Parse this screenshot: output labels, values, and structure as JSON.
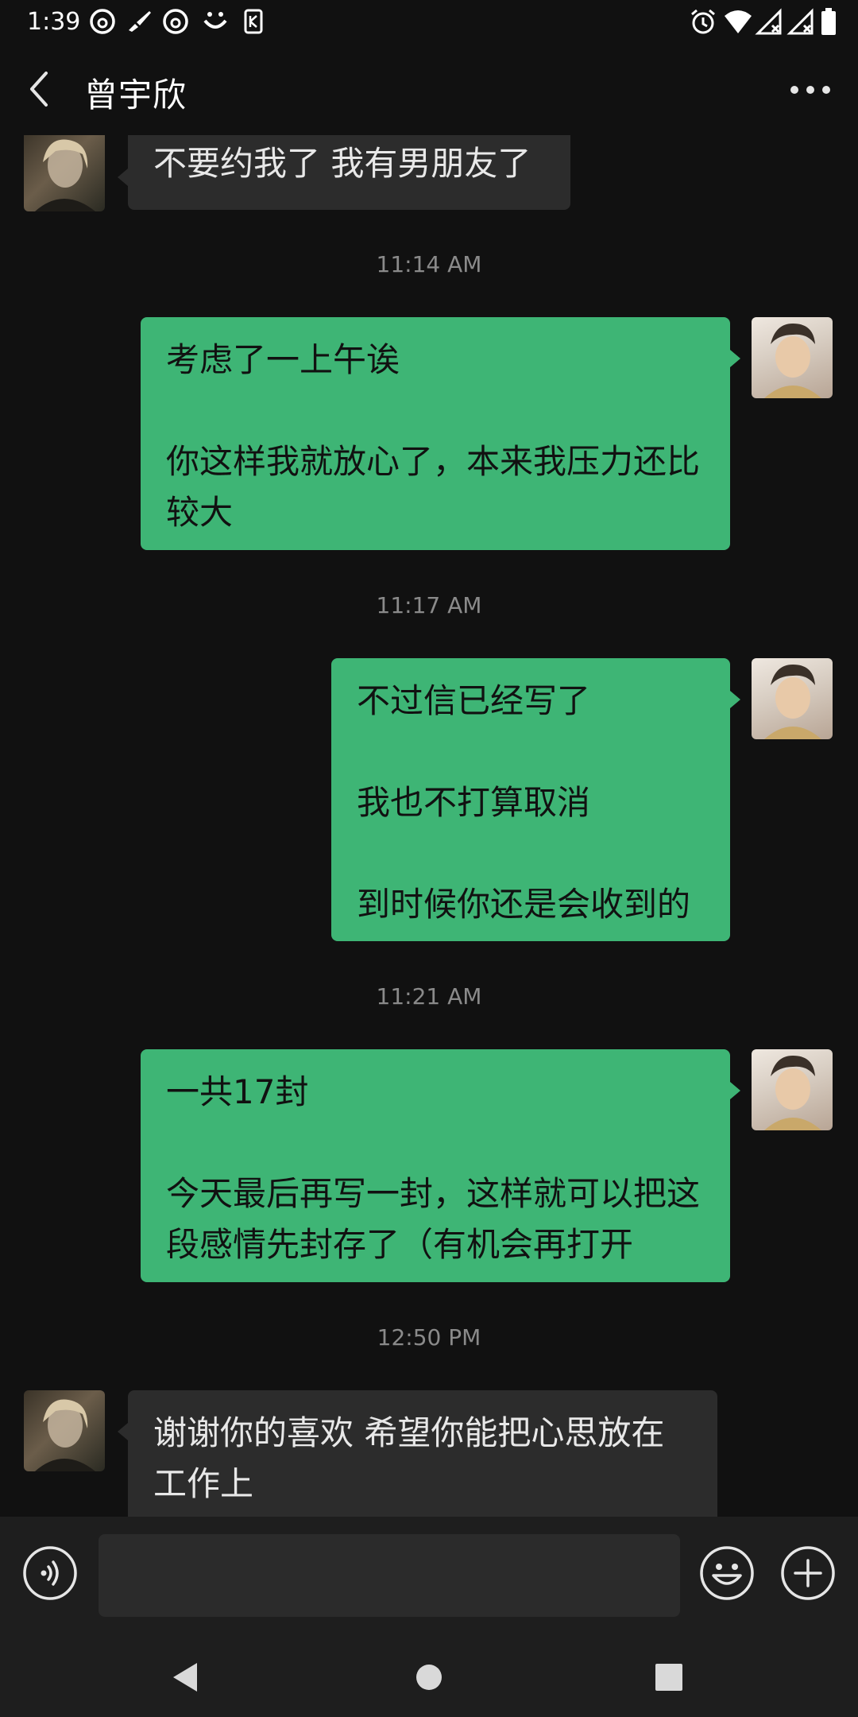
{
  "status_bar": {
    "time": "1:39"
  },
  "header": {
    "title": "曾宇欣"
  },
  "messages": [
    {
      "text": "不要约我了 我有男朋友了"
    },
    {
      "text": "考虑了一上午诶\n\n你这样我就放心了，本来我压力还比较大"
    },
    {
      "text": "不过信已经写了\n\n我也不打算取消\n\n到时候你还是会收到的"
    },
    {
      "text": "一共17封\n\n今天最后再写一封，这样就可以把这段感情先封存了（有机会再打开"
    },
    {
      "text": "谢谢你的喜欢 希望你能把心思放在工作上"
    }
  ],
  "timestamps": [
    "11:14 AM",
    "11:17 AM",
    "11:21 AM",
    "12:50 PM"
  ],
  "colors": {
    "background": "#111111",
    "outgoing_bubble": "#3eb575",
    "incoming_bubble": "#2c2c2c"
  },
  "icons": [
    "back-arrow",
    "more-dots",
    "voice",
    "emoji",
    "plus",
    "nav-back",
    "nav-home",
    "nav-recents"
  ]
}
